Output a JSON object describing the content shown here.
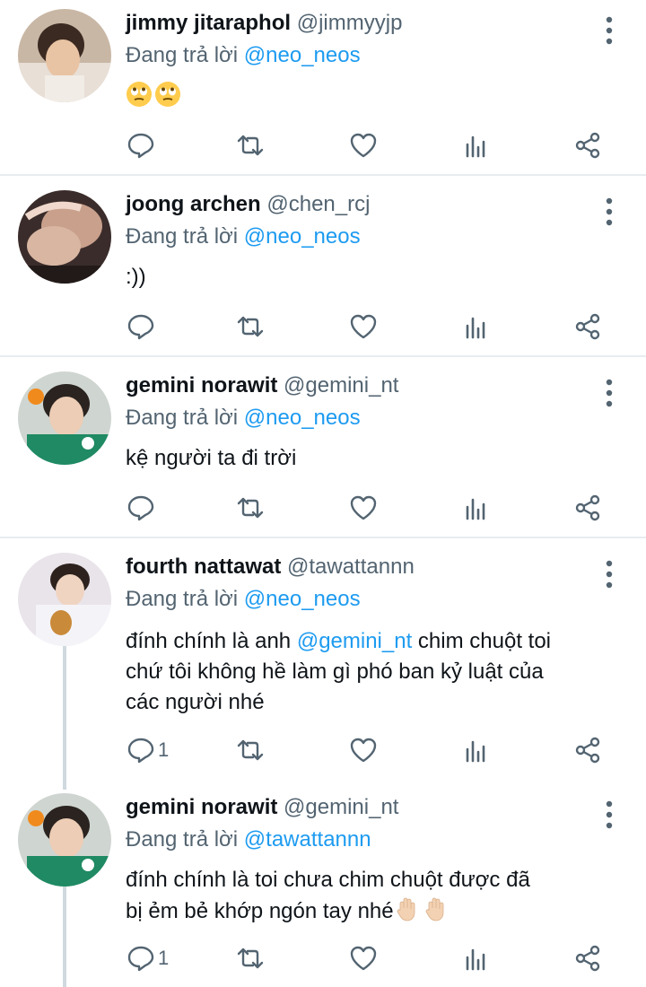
{
  "tweets": [
    {
      "name": "jimmy jitaraphol",
      "handle": "@jimmyyjp",
      "reply_prefix": "Đang trả lời",
      "reply_to": "@neo_neos",
      "text_lines": [],
      "emoji": [
        "eye-roll-emoji",
        "eye-roll-emoji"
      ],
      "reply_count": ""
    },
    {
      "name": "joong archen",
      "handle": "@chen_rcj",
      "reply_prefix": "Đang trả lời",
      "reply_to": "@neo_neos",
      "text_lines": [
        ":))"
      ],
      "reply_count": ""
    },
    {
      "name": "gemini norawit",
      "handle": "@gemini_nt",
      "reply_prefix": "Đang trả lời",
      "reply_to": "@neo_neos",
      "text_lines": [
        "kệ người ta đi trời"
      ],
      "reply_count": ""
    },
    {
      "name": "fourth nattawat",
      "handle": "@tawattannn",
      "reply_prefix": "Đang trả lời",
      "reply_to": "@neo_neos",
      "text_pre": "đính chính là anh ",
      "text_mention": "@gemini_nt",
      "text_post": " chim chuột toi",
      "text_lines": [
        "chứ tôi không hề làm gì phó ban kỷ luật của",
        "các người nhé"
      ],
      "reply_count": "1"
    },
    {
      "name": "gemini norawit",
      "handle": "@gemini_nt",
      "reply_prefix": "Đang trả lời",
      "reply_to": "@tawattannn",
      "text_lines": [
        "đính chính là toi chưa chim chuột được đã",
        "bị ẻm bẻ khớp ngón tay nhé"
      ],
      "emoji": [
        "raised-hand-emoji",
        "raised-hand-emoji"
      ],
      "reply_count": "1"
    }
  ],
  "colors": {
    "accent": "#1d9bf0",
    "secondary_text": "#536471",
    "divider": "#e7ecef",
    "thread_line": "#cfd9de"
  },
  "icons": [
    "reply-icon",
    "retweet-icon",
    "like-icon",
    "views-icon",
    "share-icon",
    "more-options-icon"
  ]
}
